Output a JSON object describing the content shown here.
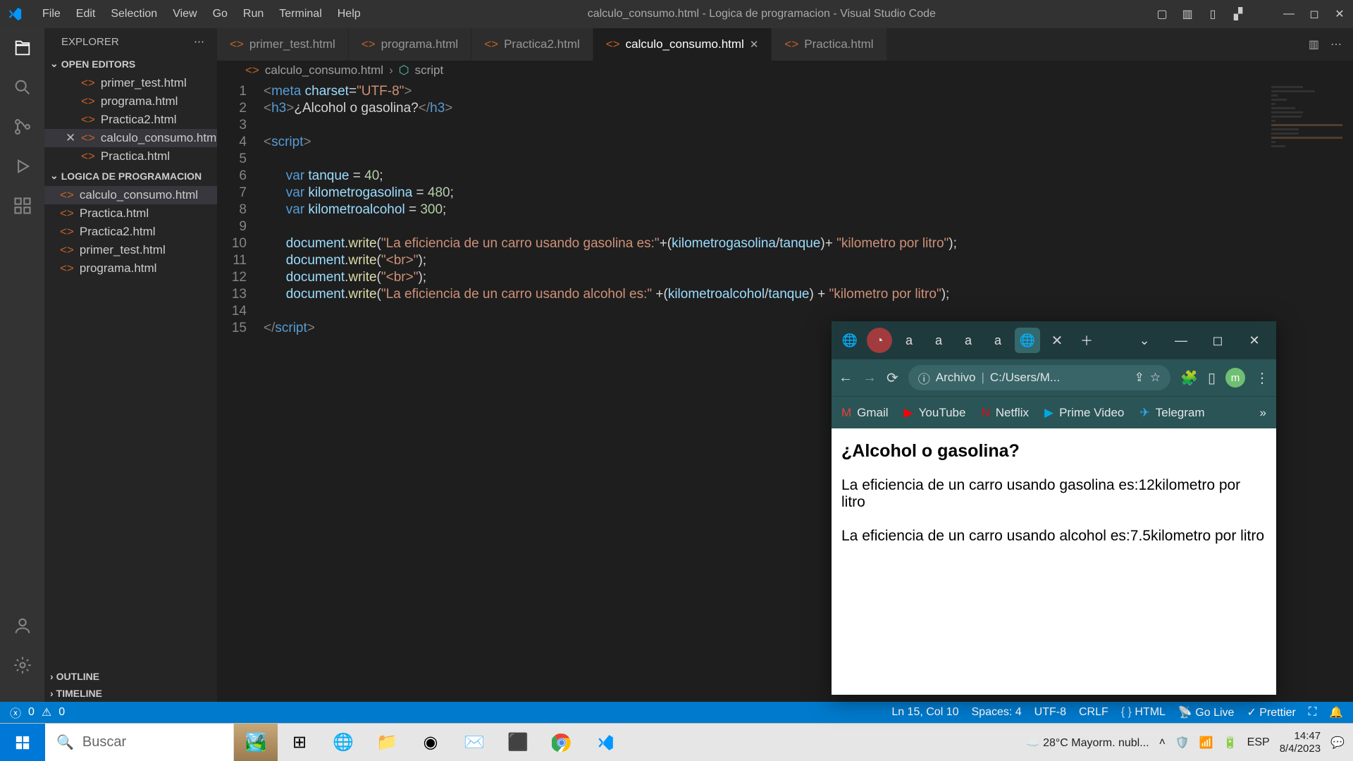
{
  "title_bar": {
    "menus": [
      "File",
      "Edit",
      "Selection",
      "View",
      "Go",
      "Run",
      "Terminal",
      "Help"
    ],
    "title": "calculo_consumo.html - Logica de programacion - Visual Studio Code"
  },
  "sidebar": {
    "header": "EXPLORER",
    "open_editors_label": "OPEN EDITORS",
    "open_editors": [
      "primer_test.html",
      "programa.html",
      "Practica2.html",
      "calculo_consumo.html",
      "Practica.html"
    ],
    "folder_label": "LOGICA DE PROGRAMACION",
    "folder_files": [
      "calculo_consumo.html",
      "Practica.html",
      "Practica2.html",
      "primer_test.html",
      "programa.html"
    ],
    "outline": "OUTLINE",
    "timeline": "TIMELINE"
  },
  "tabs": [
    "primer_test.html",
    "programa.html",
    "Practica2.html",
    "calculo_consumo.html",
    "Practica.html"
  ],
  "active_tab_index": 3,
  "breadcrumb": {
    "file": "calculo_consumo.html",
    "sym": "script"
  },
  "code_lines": 15,
  "status": {
    "errors": "0",
    "warnings": "0",
    "ln_col": "Ln 15, Col 10",
    "spaces": "Spaces: 4",
    "encoding": "UTF-8",
    "eol": "CRLF",
    "lang": "HTML",
    "golive": "Go Live",
    "prettier": "Prettier"
  },
  "taskbar": {
    "search_placeholder": "Buscar",
    "weather": "28°C  Mayorm. nubl...",
    "lang": "ESP",
    "time": "14:47",
    "date": "8/4/2023"
  },
  "browser": {
    "addr_label": "Archivo",
    "addr_path": "C:/Users/M...",
    "bookmarks": [
      "Gmail",
      "YouTube",
      "Netflix",
      "Prime Video",
      "Telegram"
    ],
    "page": {
      "heading": "¿Alcohol o gasolina?",
      "line1": "La eficiencia de un carro usando gasolina es:12kilometro por litro",
      "line2": "La eficiencia de un carro usando alcohol es:7.5kilometro por litro"
    }
  }
}
